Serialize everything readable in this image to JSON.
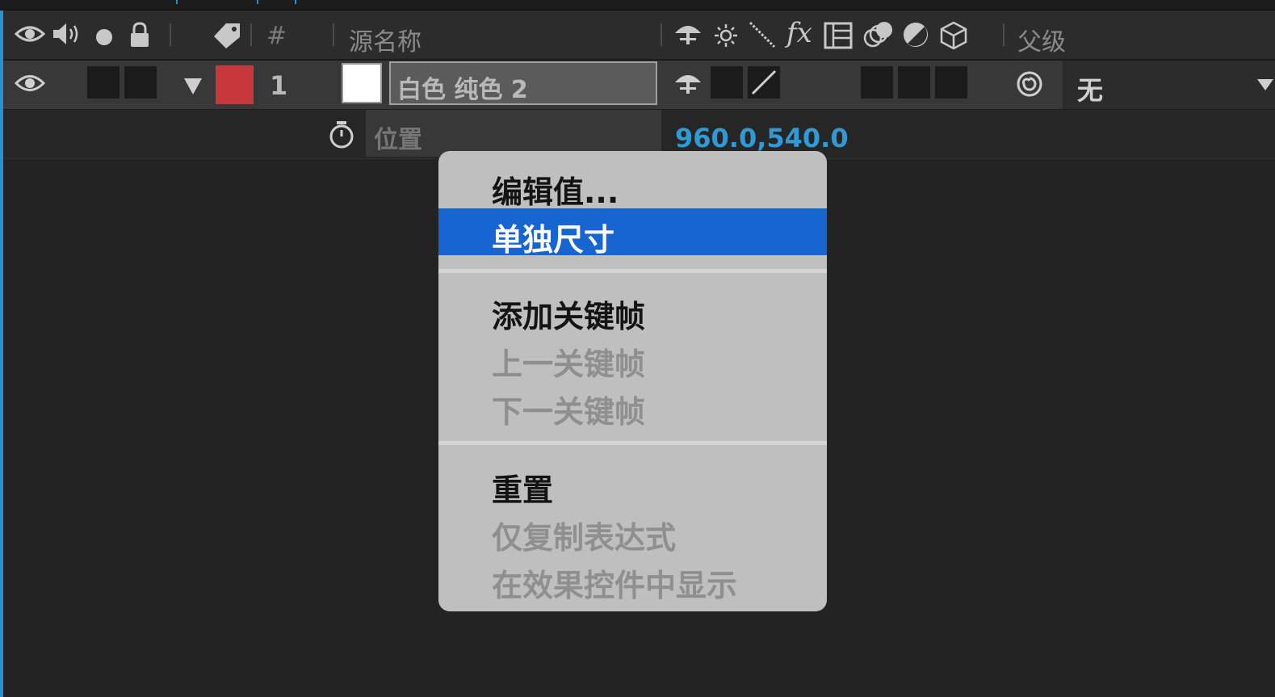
{
  "header": {
    "column_number": "#",
    "column_source_name": "源名称",
    "column_parent": "父级",
    "fx_label": "fx",
    "icons": [
      "eye-icon",
      "speaker-icon",
      "solo-dot-icon",
      "lock-icon",
      "label-tag-icon",
      "shy-icon",
      "collapse-sun-icon",
      "quality-slash-icon",
      "fx-icon",
      "frame-blend-icon",
      "motion-blur-icon",
      "adjustment-layer-icon",
      "3d-cube-icon"
    ]
  },
  "layer": {
    "number": "1",
    "name": "白色 纯色 2",
    "parent_value": "无",
    "label_color": "#c8383a"
  },
  "property": {
    "name": "位置",
    "value": "960.0,540.0",
    "value_color": "#2f9ad6"
  },
  "context_menu": {
    "items": [
      {
        "label": "编辑值...",
        "enabled": true
      },
      {
        "label": "单独尺寸",
        "enabled": true,
        "selected": true
      },
      {
        "label": "添加关键帧",
        "enabled": true
      },
      {
        "label": "上一关键帧",
        "enabled": false
      },
      {
        "label": "下一关键帧",
        "enabled": false
      },
      {
        "label": "重置",
        "enabled": true
      },
      {
        "label": "仅复制表达式",
        "enabled": false
      },
      {
        "label": "在效果控件中显示",
        "enabled": false
      }
    ],
    "highlight_color": "#1765d0"
  }
}
